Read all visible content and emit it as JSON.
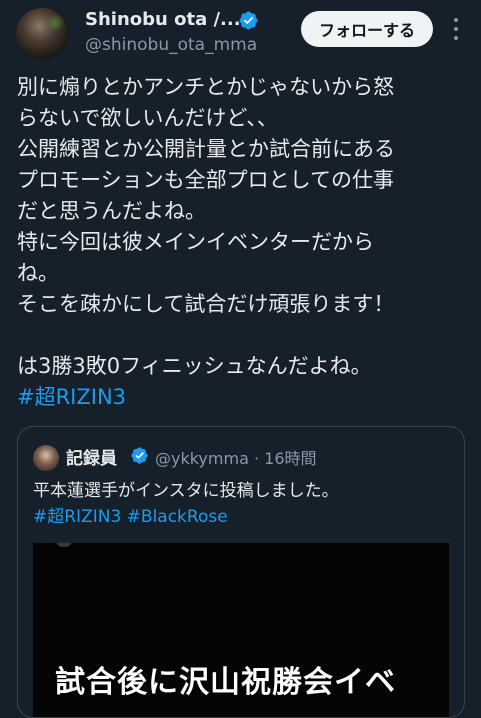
{
  "post": {
    "author_name": "Shinobu ota /...",
    "author_handle": "@shinobu_ota_mma",
    "follow_label": "フォローする",
    "body_lines": [
      "別に煽りとかアンチとかじゃないから怒",
      "らないで欲しいんだけど、、",
      "公開練習とか公開計量とか試合前にある",
      "プロモーションも全部プロとしての仕事",
      "だと思うんだよね。",
      "特に今回は彼メインイベンターだから",
      "ね。",
      "そこを疎かにして試合だけ頑張ります！",
      "",
      "は3勝3敗0フィニッシュなんだよね。"
    ],
    "hashtag": "#超RIZIN3"
  },
  "quote": {
    "author_name": "記録員",
    "meta": "@ykkymma · 16時間",
    "text_line1": "平本蓮選手がインスタに投稿しました。",
    "text_line2": "#超RIZIN3 #BlackRose",
    "media_caption": "試合後に沢山祝勝会イベ"
  },
  "icons": {
    "verified": "verified-badge-icon",
    "more": "more-options-icon"
  },
  "colors": {
    "background": "#15202b",
    "text": "#e7e9ea",
    "secondary_text": "#8b98a5",
    "link": "#1d9bf0",
    "border": "#38444d",
    "button_bg": "#eff3f4"
  }
}
